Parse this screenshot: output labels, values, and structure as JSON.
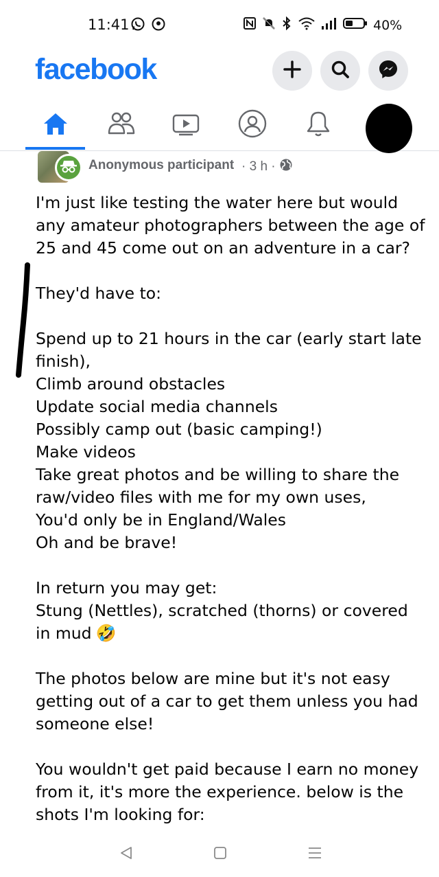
{
  "status_bar": {
    "time": "11:41",
    "battery_percent": "40%",
    "icons": [
      "whatsapp-icon",
      "location-icon",
      "nfc-icon",
      "mute-icon",
      "bluetooth-icon",
      "wifi-icon",
      "signal-icon",
      "battery-icon"
    ]
  },
  "header": {
    "logo": "facebook",
    "brand_color": "#1877f2",
    "buttons": [
      "plus-icon",
      "search-icon",
      "messenger-icon"
    ]
  },
  "nav": {
    "tabs": [
      "home",
      "friends",
      "watch",
      "profile",
      "notifications",
      "menu"
    ],
    "active_tab": "home"
  },
  "post": {
    "author": "Anonymous participant",
    "meta": "· 3 h ·",
    "lines": [
      "I'm just like testing the water here but would",
      "any amateur photographers between the age of",
      "25 and 45 come out on an adventure in a car?",
      "",
      "They'd have to:",
      "",
      "Spend up to 21 hours in the car (early start late",
      "finish),",
      "Climb around obstacles",
      "Update social media channels",
      "Possibly camp out (basic camping!)",
      "Make videos",
      "Take great photos and be willing to share the",
      "raw/video files with me for my own uses,",
      "You'd only be in England/Wales",
      "Oh and be brave!",
      "",
      "In return you may get:",
      "Stung (Nettles), scratched (thorns) or covered",
      "in mud",
      "",
      "The photos below are mine but it's not easy",
      "getting out of a car to get them unless you had",
      "someone else!",
      "",
      "You wouldn't get paid because I earn no money",
      "from it, it's more the experience. below is the",
      "shots I'm looking for:"
    ],
    "emoji_after_line": 19,
    "emoji": "🤣"
  }
}
